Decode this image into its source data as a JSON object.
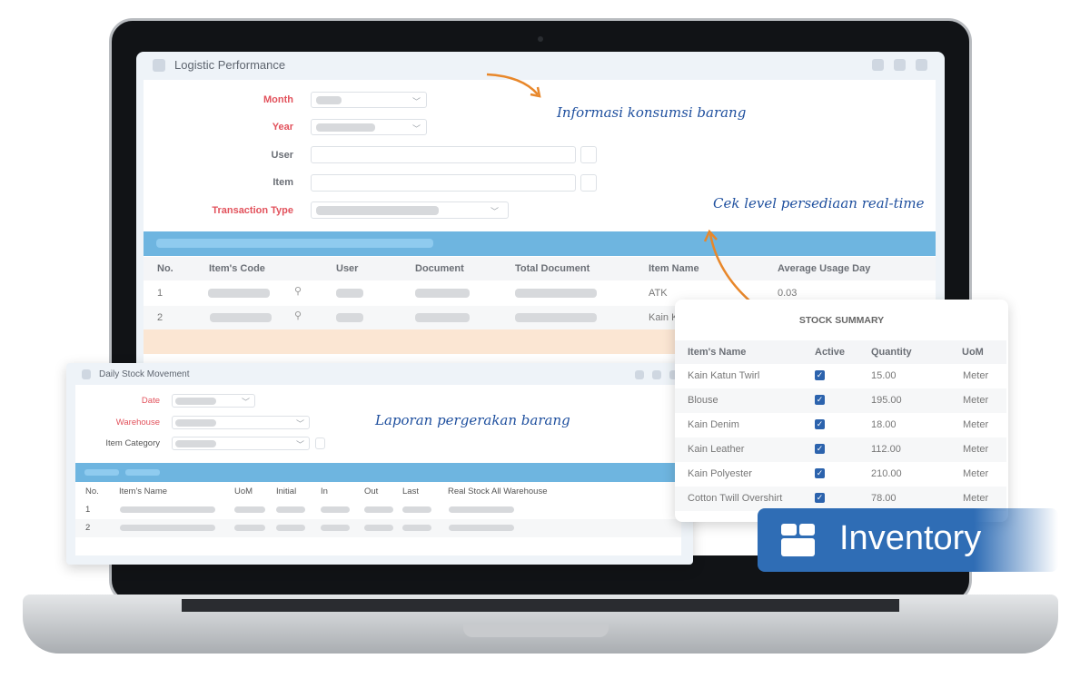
{
  "main_window": {
    "title": "Logistic Performance",
    "form": {
      "month": "Month",
      "year": "Year",
      "user": "User",
      "item": "Item",
      "transaction_type": "Transaction Type"
    },
    "table": {
      "headers": [
        "No.",
        "Item's Code",
        "User",
        "Document",
        "Total Document",
        "Item Name",
        "Average Usage Day"
      ],
      "rows": [
        {
          "no": "1",
          "item_name": "ATK",
          "avg": "0.03"
        },
        {
          "no": "2",
          "item_name": "Kain K",
          "avg": ""
        }
      ]
    }
  },
  "annotations": {
    "consumption": "Informasi konsumsi barang",
    "stock_level": "Cek level persediaan real-time",
    "movement": "Laporan pergerakan barang"
  },
  "stock_summary": {
    "title": "STOCK SUMMARY",
    "headers": [
      "Item's Name",
      "Active",
      "Quantity",
      "UoM"
    ],
    "rows": [
      {
        "name": "Kain Katun Twirl",
        "active": true,
        "qty": "15.00",
        "uom": "Meter"
      },
      {
        "name": "Blouse",
        "active": true,
        "qty": "195.00",
        "uom": "Meter"
      },
      {
        "name": "Kain Denim",
        "active": true,
        "qty": "18.00",
        "uom": "Meter"
      },
      {
        "name": "Kain Leather",
        "active": true,
        "qty": "112.00",
        "uom": "Meter"
      },
      {
        "name": "Kain Polyester",
        "active": true,
        "qty": "210.00",
        "uom": "Meter"
      },
      {
        "name": "Cotton Twill Overshirt",
        "active": true,
        "qty": "78.00",
        "uom": "Meter"
      }
    ]
  },
  "daily_window": {
    "title": "Daily Stock Movement",
    "form": {
      "date": "Date",
      "warehouse": "Warehouse",
      "item_category": "Item Category"
    },
    "table": {
      "headers": [
        "No.",
        "Item's Name",
        "UoM",
        "Initial",
        "In",
        "Out",
        "Last",
        "Real Stock All Warehouse"
      ],
      "rows": [
        "1",
        "2"
      ]
    }
  },
  "badge": {
    "label": "Inventory",
    "icon": "box-icon",
    "color": "#2f6db5"
  },
  "colors": {
    "accent_blue": "#6eb5e0",
    "required_red": "#e2525c",
    "annotation": "#1e4f9e",
    "arrow": "#e8872a"
  }
}
